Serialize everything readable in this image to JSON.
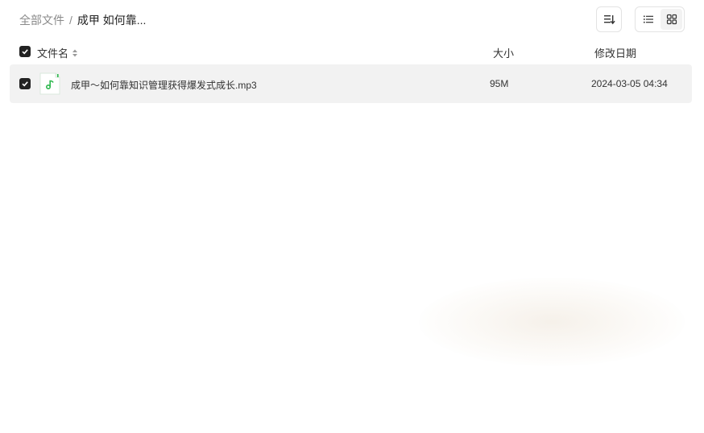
{
  "breadcrumb": {
    "root": "全部文件",
    "separator": "/",
    "current": "成甲 如何靠..."
  },
  "toolbar": {
    "sort_icon": "sort-list-icon",
    "view_modes": [
      "list-view-icon",
      "grid-view-icon"
    ],
    "active_view": "list"
  },
  "table": {
    "columns": {
      "name": "文件名",
      "size": "大小",
      "date": "修改日期"
    },
    "select_all_checked": true,
    "rows": [
      {
        "name": "成甲～如何靠知识管理获得爆发式成长.mp3",
        "size": "95M",
        "modified": "2024-03-05 04:34",
        "icon": "audio-file-icon",
        "checked": true
      }
    ]
  },
  "colors": {
    "accent": "#222222",
    "row_selected_bg": "#f2f2f2",
    "audio_icon": "#2db84d",
    "muted_text": "#8a8a8a"
  }
}
